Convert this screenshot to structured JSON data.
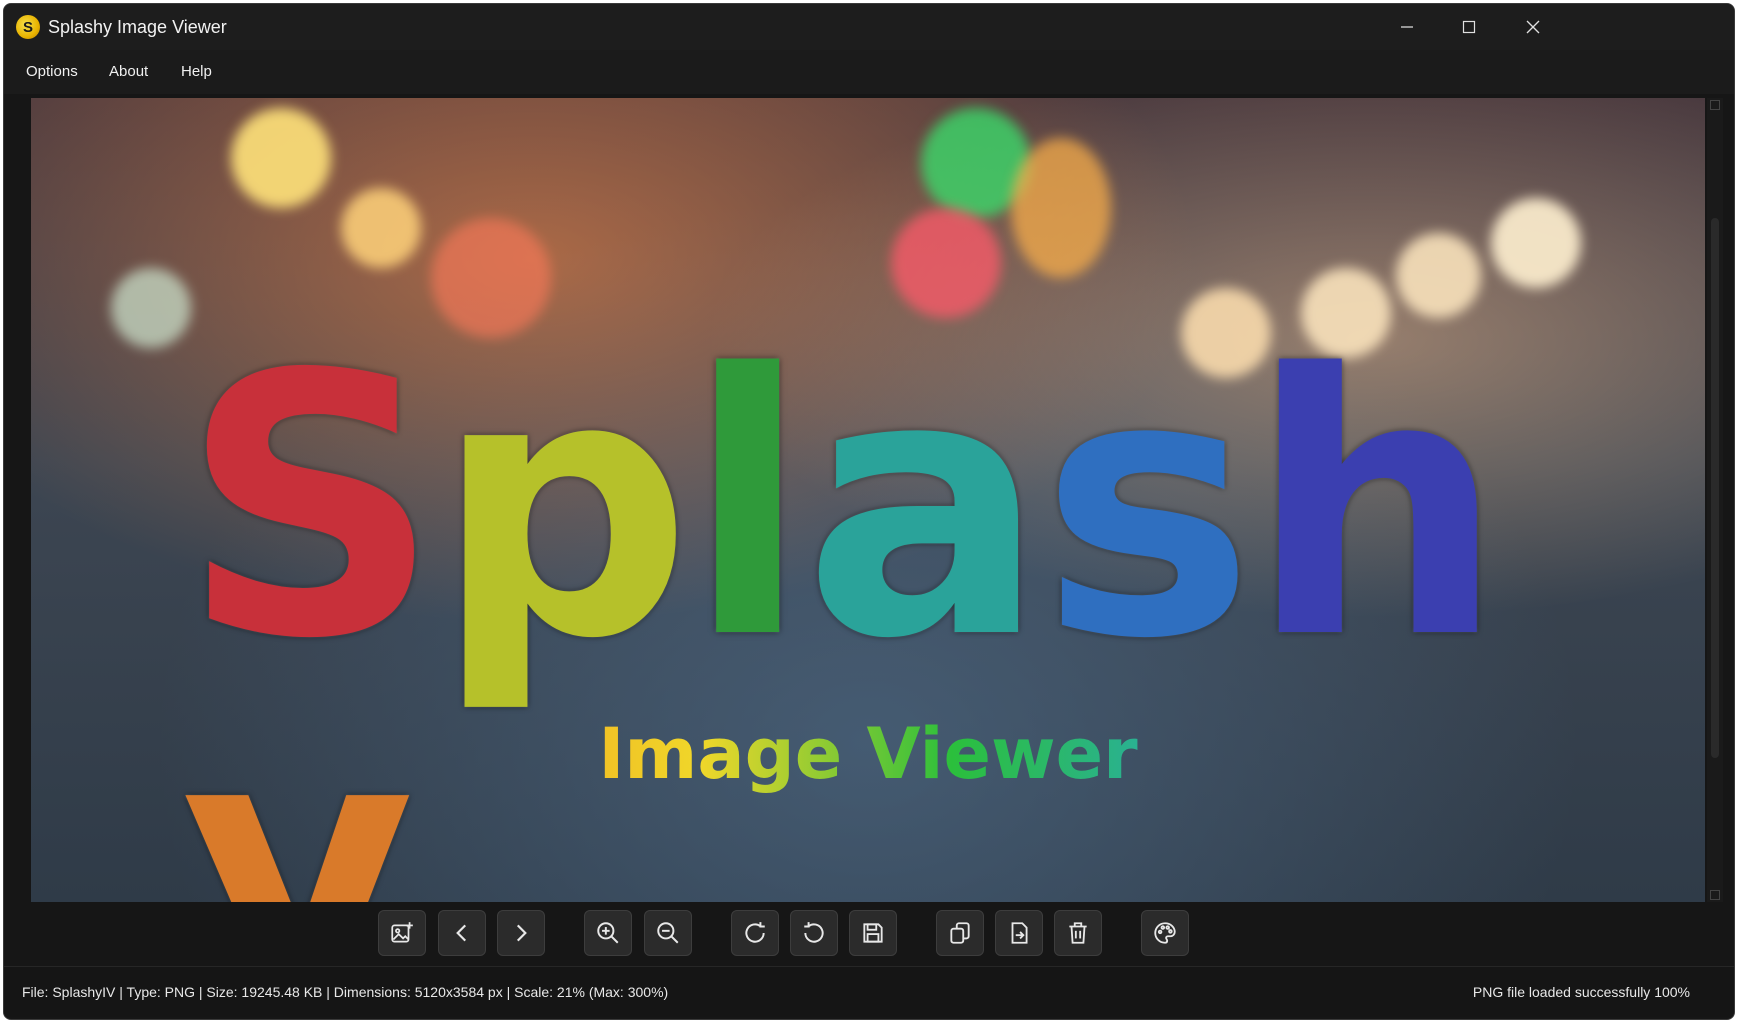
{
  "window": {
    "title": "Splashy Image Viewer",
    "logo_letter": "S"
  },
  "menu": {
    "items": [
      {
        "label": "Options"
      },
      {
        "label": "About"
      },
      {
        "label": "Help"
      }
    ]
  },
  "image": {
    "headline_letters": [
      "S",
      "p",
      "l",
      "a",
      "s",
      "h",
      "y"
    ],
    "headline_colors": [
      "#c8303a",
      "#b6c12a",
      "#2f9a3a",
      "#2aa39a",
      "#2f6fc0",
      "#3b3fb0",
      "#d97a2a"
    ],
    "subtitle": "Image Viewer"
  },
  "toolbar": {
    "buttons": [
      {
        "name": "open-image",
        "icon": "image-add-icon"
      },
      {
        "name": "previous-image",
        "icon": "chevron-left-icon"
      },
      {
        "name": "next-image",
        "icon": "chevron-right-icon"
      },
      {
        "name": "zoom-in",
        "icon": "zoom-in-icon"
      },
      {
        "name": "zoom-out",
        "icon": "zoom-out-icon"
      },
      {
        "name": "rotate-clockwise",
        "icon": "rotate-cw-icon"
      },
      {
        "name": "rotate-counterclockwise",
        "icon": "rotate-ccw-icon"
      },
      {
        "name": "save",
        "icon": "save-icon"
      },
      {
        "name": "copy",
        "icon": "copy-icon"
      },
      {
        "name": "move",
        "icon": "move-file-icon"
      },
      {
        "name": "delete",
        "icon": "trash-icon"
      },
      {
        "name": "theme",
        "icon": "palette-icon"
      }
    ]
  },
  "status": {
    "info": "File: SplashyIV | Type: PNG | Size: 19245.48 KB | Dimensions: 5120x3584 px | Scale: 21% (Max: 300%)",
    "message": "PNG file loaded successfully 100%"
  },
  "colors": {
    "window_bg": "#161616",
    "titlebar_bg": "#1d1d1d",
    "button_bg": "#2b2b2b",
    "text": "#f0f0f0"
  }
}
